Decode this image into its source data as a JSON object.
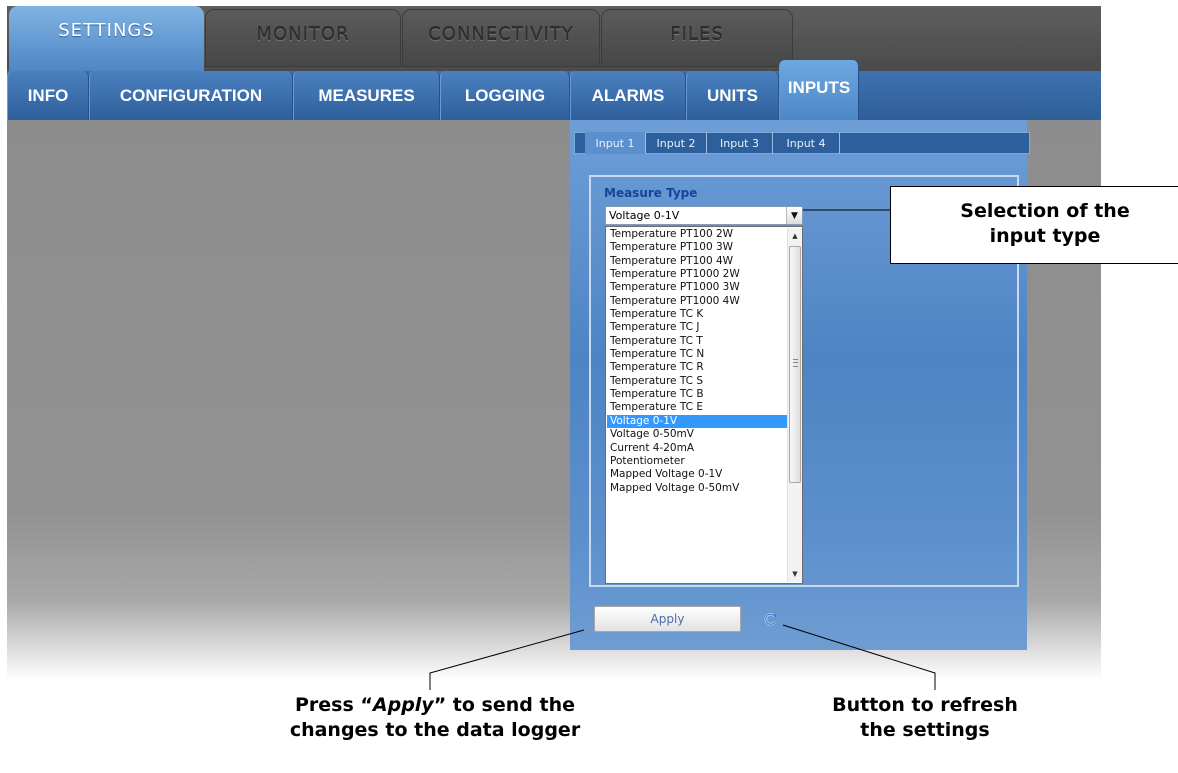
{
  "main_tabs": [
    {
      "label": "SETTINGS",
      "active": true
    },
    {
      "label": "MONITOR",
      "active": false
    },
    {
      "label": "CONNECTIVITY",
      "active": false
    },
    {
      "label": "FILES",
      "active": false
    }
  ],
  "sub_tabs": [
    {
      "label": "INFO"
    },
    {
      "label": "CONFIGURATION"
    },
    {
      "label": "MEASURES"
    },
    {
      "label": "LOGGING"
    },
    {
      "label": "ALARMS"
    },
    {
      "label": "UNITS"
    },
    {
      "label": "INPUTS",
      "active": true
    }
  ],
  "input_tabs": [
    {
      "label": "Input 1",
      "active": true
    },
    {
      "label": "Input 2"
    },
    {
      "label": "Input 3"
    },
    {
      "label": "Input 4"
    }
  ],
  "measure_type": {
    "label": "Measure Type",
    "selected": "Voltage 0-1V",
    "options": [
      "Temperature PT100 2W",
      "Temperature PT100 3W",
      "Temperature PT100 4W",
      "Temperature PT1000 2W",
      "Temperature PT1000 3W",
      "Temperature PT1000 4W",
      "Temperature TC K",
      "Temperature TC J",
      "Temperature TC T",
      "Temperature TC N",
      "Temperature TC R",
      "Temperature TC S",
      "Temperature TC B",
      "Temperature TC E",
      "Voltage 0-1V",
      "Voltage 0-50mV",
      "Current 4-20mA",
      "Potentiometer",
      "Mapped Voltage 0-1V",
      "Mapped Voltage 0-50mV"
    ],
    "highlighted_index": 14
  },
  "apply_label": "Apply",
  "callouts": {
    "input_type": {
      "line1": "Selection of the",
      "line2": "input type"
    },
    "apply": {
      "prefix": "Press “",
      "emphasis": "Apply",
      "suffix": "” to send the",
      "line2": "changes to the data logger"
    },
    "refresh": {
      "line1": "Button to refresh",
      "line2": "the settings"
    }
  },
  "colors": {
    "active_tab": "#6ea8e3",
    "sub_bar": "#3f72b1",
    "selection": "#3399ff",
    "label_blue": "#16449a"
  },
  "icons": {
    "dropdown": "chevron-down-icon",
    "refresh": "refresh-icon",
    "scroll_up": "triangle-up-icon",
    "scroll_down": "triangle-down-icon"
  }
}
